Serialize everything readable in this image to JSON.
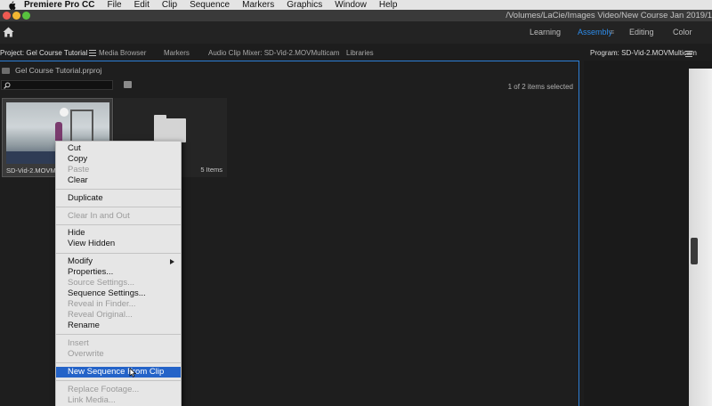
{
  "menubar": {
    "app": "Premiere Pro CC",
    "items": [
      "File",
      "Edit",
      "Clip",
      "Sequence",
      "Markers",
      "Graphics",
      "Window",
      "Help"
    ]
  },
  "titlebar": {
    "path": "/Volumes/LaCie/Images Video/New Course Jan 2019/1"
  },
  "workspaces": {
    "tabs": [
      "Learning",
      "Assembly",
      "Editing",
      "Color"
    ],
    "active": "Assembly"
  },
  "project_panel": {
    "tabs": [
      "Project: Gel Course Tutorial",
      "Media Browser",
      "Markers",
      "Audio Clip Mixer: SD-Vid-2.MOVMulticam",
      "Libraries"
    ],
    "project_file": "Gel Course Tutorial.prproj",
    "search_placeholder": "",
    "selected_count": "1 of 2 items selected",
    "clip_label": "SD-Vid-2.MOVMulti",
    "bin_count": "5 Items"
  },
  "program_monitor": {
    "title": "Program: SD-Vid-2.MOVMulticam"
  },
  "context_menu": {
    "items": [
      {
        "label": "Cut",
        "disabled": false
      },
      {
        "label": "Copy",
        "disabled": false
      },
      {
        "label": "Paste",
        "disabled": true
      },
      {
        "label": "Clear",
        "disabled": false
      },
      {
        "label": "Duplicate",
        "disabled": false
      },
      {
        "label": "Clear In and Out",
        "disabled": true
      },
      {
        "label": "Hide",
        "disabled": false
      },
      {
        "label": "View Hidden",
        "disabled": false
      },
      {
        "label": "Modify",
        "disabled": false,
        "submenu": true
      },
      {
        "label": "Properties...",
        "disabled": false
      },
      {
        "label": "Source Settings...",
        "disabled": true
      },
      {
        "label": "Sequence Settings...",
        "disabled": false
      },
      {
        "label": "Reveal in Finder...",
        "disabled": true
      },
      {
        "label": "Reveal Original...",
        "disabled": true
      },
      {
        "label": "Rename",
        "disabled": false
      },
      {
        "label": "Insert",
        "disabled": true
      },
      {
        "label": "Overwrite",
        "disabled": true
      },
      {
        "label": "New Sequence From Clip",
        "disabled": false,
        "highlighted": true
      },
      {
        "label": "Replace Footage...",
        "disabled": true
      },
      {
        "label": "Link Media...",
        "disabled": true
      }
    ]
  },
  "colors": {
    "accent": "#2d8ceb",
    "menu_highlight": "#2463c8"
  }
}
